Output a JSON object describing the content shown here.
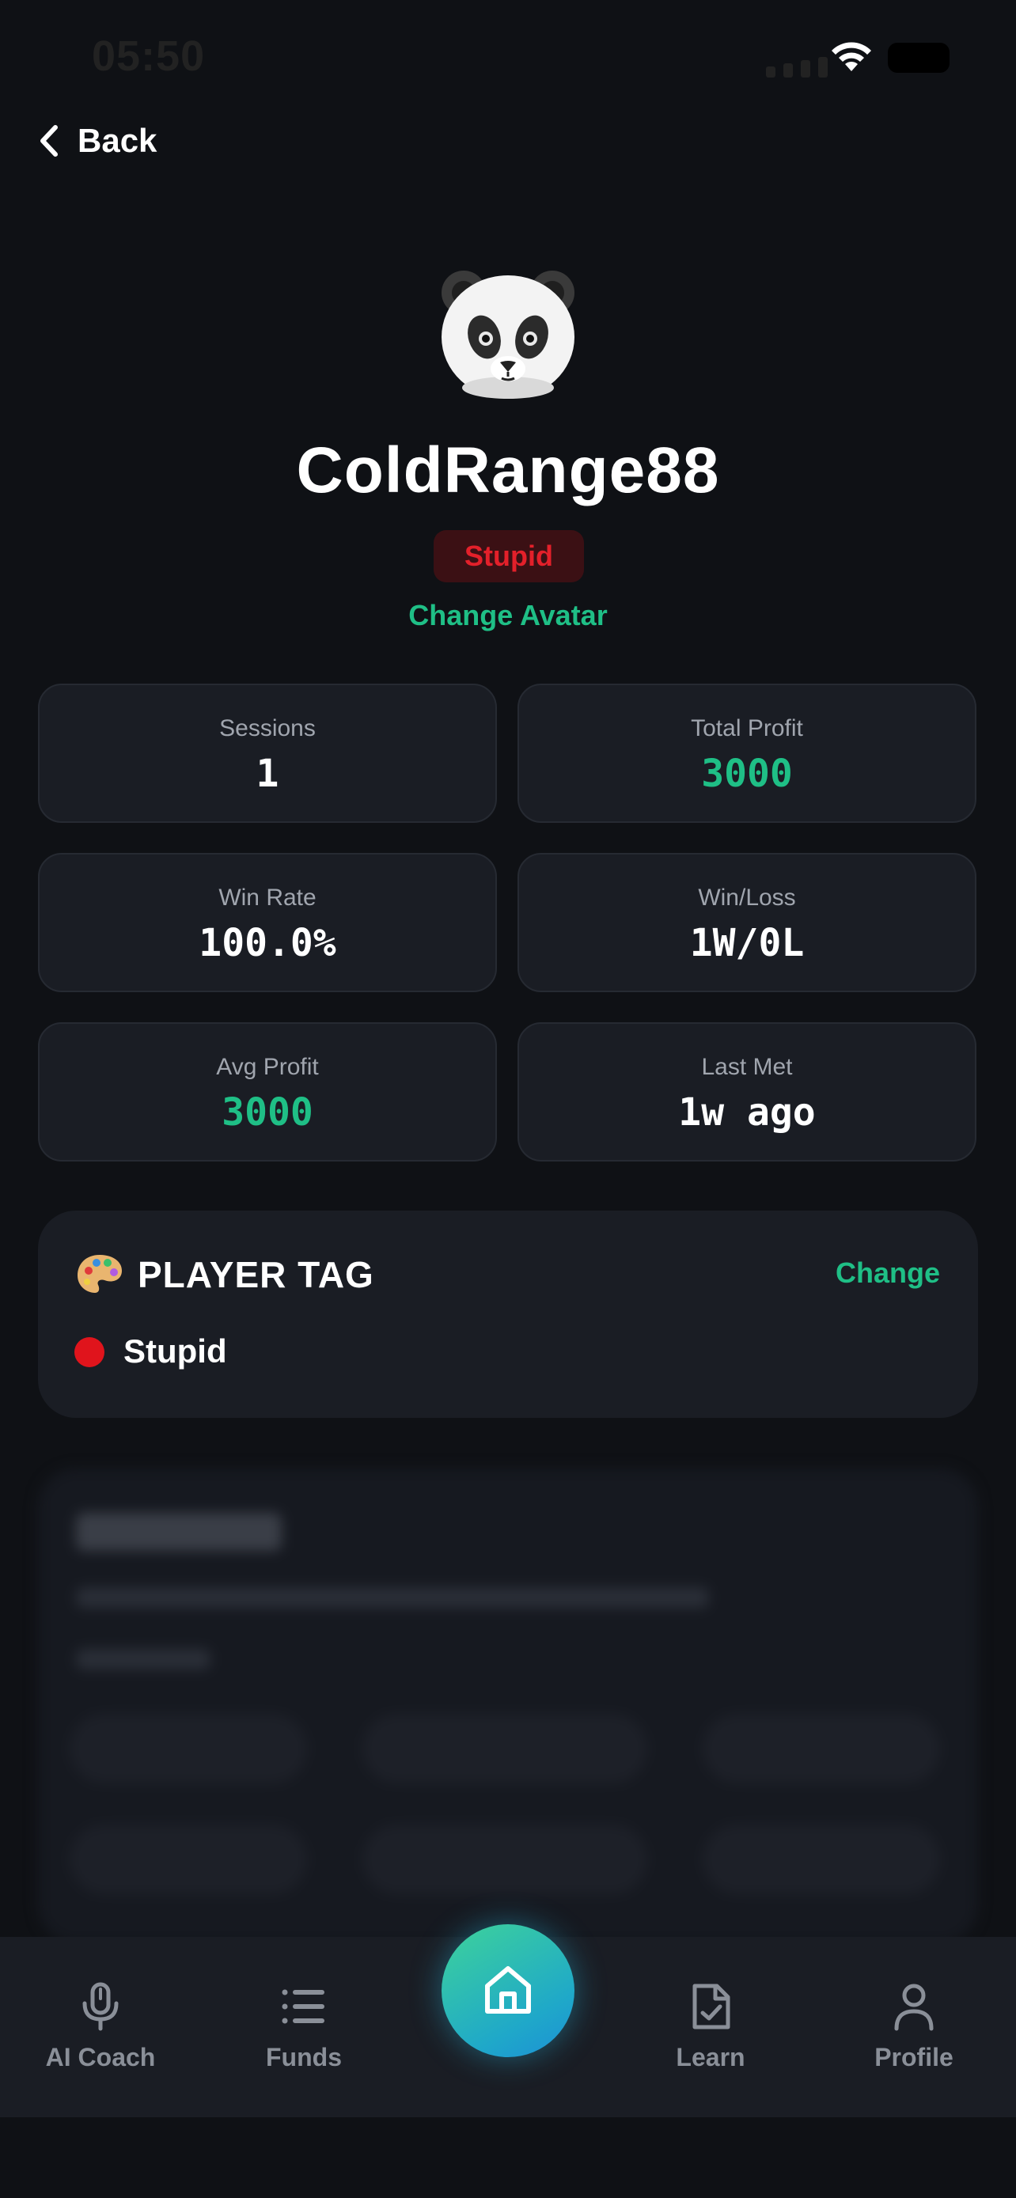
{
  "status_bar": {
    "time": "05:50"
  },
  "nav": {
    "back_label": "Back"
  },
  "profile": {
    "username": "ColdRange88",
    "tag_badge": "Stupid",
    "change_avatar": "Change Avatar"
  },
  "stats": [
    {
      "label": "Sessions",
      "value": "1"
    },
    {
      "label": "Total Profit",
      "value": "3000"
    },
    {
      "label": "Win Rate",
      "value": "100.0%"
    },
    {
      "label": "Win/Loss",
      "value": "1W/0L"
    },
    {
      "label": "Avg Profit",
      "value": "3000"
    },
    {
      "label": "Last Met",
      "value": "1w ago"
    }
  ],
  "player_tag": {
    "title": "PLAYER TAG",
    "change_label": "Change",
    "tag_name": "Stupid",
    "tag_color": "#e0141c"
  },
  "tabbar": {
    "items": [
      {
        "label": "AI Coach",
        "icon": "microphone-icon"
      },
      {
        "label": "Funds",
        "icon": "list-icon"
      },
      {
        "label": "",
        "icon": "home-icon"
      },
      {
        "label": "Learn",
        "icon": "document-check-icon"
      },
      {
        "label": "Profile",
        "icon": "person-icon"
      }
    ]
  },
  "colors": {
    "accent": "#1fbf86",
    "background": "#0f1115",
    "card": "#1a1d24",
    "danger": "#e3202a"
  }
}
